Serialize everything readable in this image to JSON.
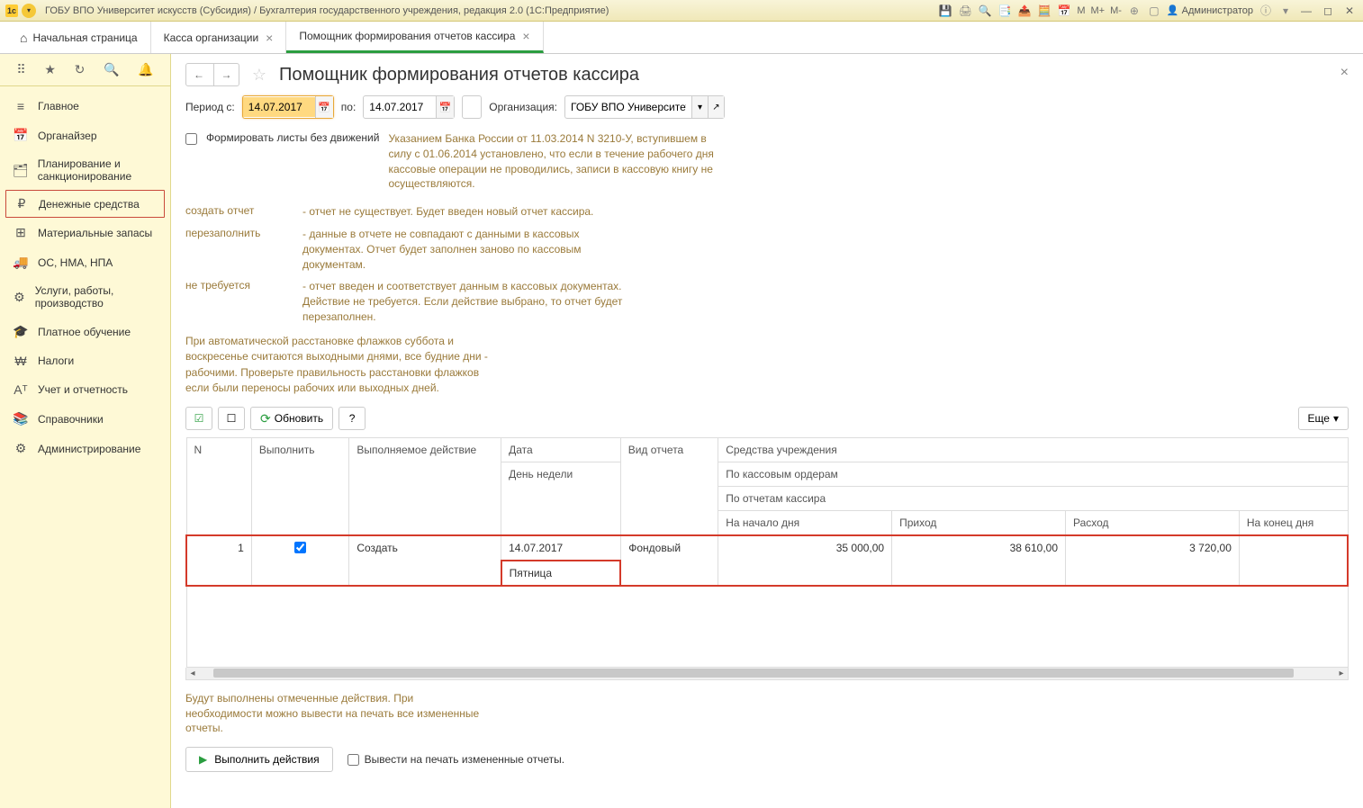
{
  "titlebar": {
    "title": "ГОБУ ВПО Университет искусств (Субсидия) / Бухгалтерия государственного учреждения, редакция 2.0  (1С:Предприятие)",
    "user": "Администратор",
    "m_text": "M",
    "m_plus": "M+",
    "m_minus": "M-"
  },
  "tabs": {
    "home": "Начальная страница",
    "items": [
      {
        "label": "Касса организации"
      },
      {
        "label": "Помощник формирования отчетов кассира"
      }
    ]
  },
  "sidebar": {
    "items": [
      {
        "icon": "≡",
        "label": "Главное"
      },
      {
        "icon": "📅",
        "label": "Органайзер"
      },
      {
        "icon": "🗂",
        "label": "Планирование и санкционирование"
      },
      {
        "icon": "₽",
        "label": "Денежные средства"
      },
      {
        "icon": "⊞",
        "label": "Материальные запасы"
      },
      {
        "icon": "🚚",
        "label": "ОС, НМА, НПА"
      },
      {
        "icon": "⚙",
        "label": "Услуги, работы, производство"
      },
      {
        "icon": "🎓",
        "label": "Платное обучение"
      },
      {
        "icon": "₩",
        "label": "Налоги"
      },
      {
        "icon": "Aᵀ",
        "label": "Учет и отчетность"
      },
      {
        "icon": "📚",
        "label": "Справочники"
      },
      {
        "icon": "⚙",
        "label": "Администрирование"
      }
    ]
  },
  "page": {
    "title": "Помощник формирования отчетов кассира",
    "period_from_label": "Период с:",
    "period_from": "14.07.2017",
    "period_to_label": "по:",
    "period_to": "14.07.2017",
    "org_label": "Организация:",
    "org_value": "ГОБУ ВПО Университет и",
    "chk_label": "Формировать листы без движений",
    "guidance": "Указанием Банка России от 11.03.2014 N 3210-У, вступившем в силу с 01.06.2014 установлено, что если в течение рабочего дня кассовые операции не проводились, записи в кассовую книгу не осуществляются.",
    "legend": [
      {
        "k": "создать отчет",
        "v": "- отчет не существует. Будет введен новый отчет кассира."
      },
      {
        "k": "перезаполнить",
        "v": "- данные в отчете не совпадают с данными в кассовых документах. Отчет будет заполнен заново по кассовым документам."
      },
      {
        "k": "не требуется",
        "v": "- отчет введен и соответствует данным в кассовых документах. Действие не требуется. Если действие выбрано, то отчет будет перезаполнен."
      }
    ],
    "note": "При автоматической расстановке флажков суббота и воскресенье считаются выходными днями, все будние дни - рабочими. Проверьте правильность расстановки флажков если были переносы рабочих или выходных дней.",
    "refresh_label": "Обновить",
    "more_label": "Еще",
    "table": {
      "headers": {
        "n": "N",
        "exec": "Выполнить",
        "action": "Выполняемое действие",
        "date": "Дата",
        "weekday": "День недели",
        "report_type": "Вид отчета",
        "funds": "Средства учреждения",
        "by_orders": "По кассовым ордерам",
        "by_reports": "По отчетам кассира",
        "start": "На начало дня",
        "income": "Приход",
        "expense": "Расход",
        "end": "На конец дня"
      },
      "row": {
        "n": "1",
        "checked": true,
        "action": "Создать",
        "date": "14.07.2017",
        "weekday": "Пятница",
        "type": "Фондовый",
        "start": "35 000,00",
        "income": "38 610,00",
        "expense": "3 720,00",
        "end": ""
      }
    },
    "footer_note": "Будут выполнены отмеченные действия. При необходимости можно вывести на печать все измененные отчеты.",
    "run_label": "Выполнить действия",
    "print_check_label": "Вывести на печать измененные отчеты."
  }
}
